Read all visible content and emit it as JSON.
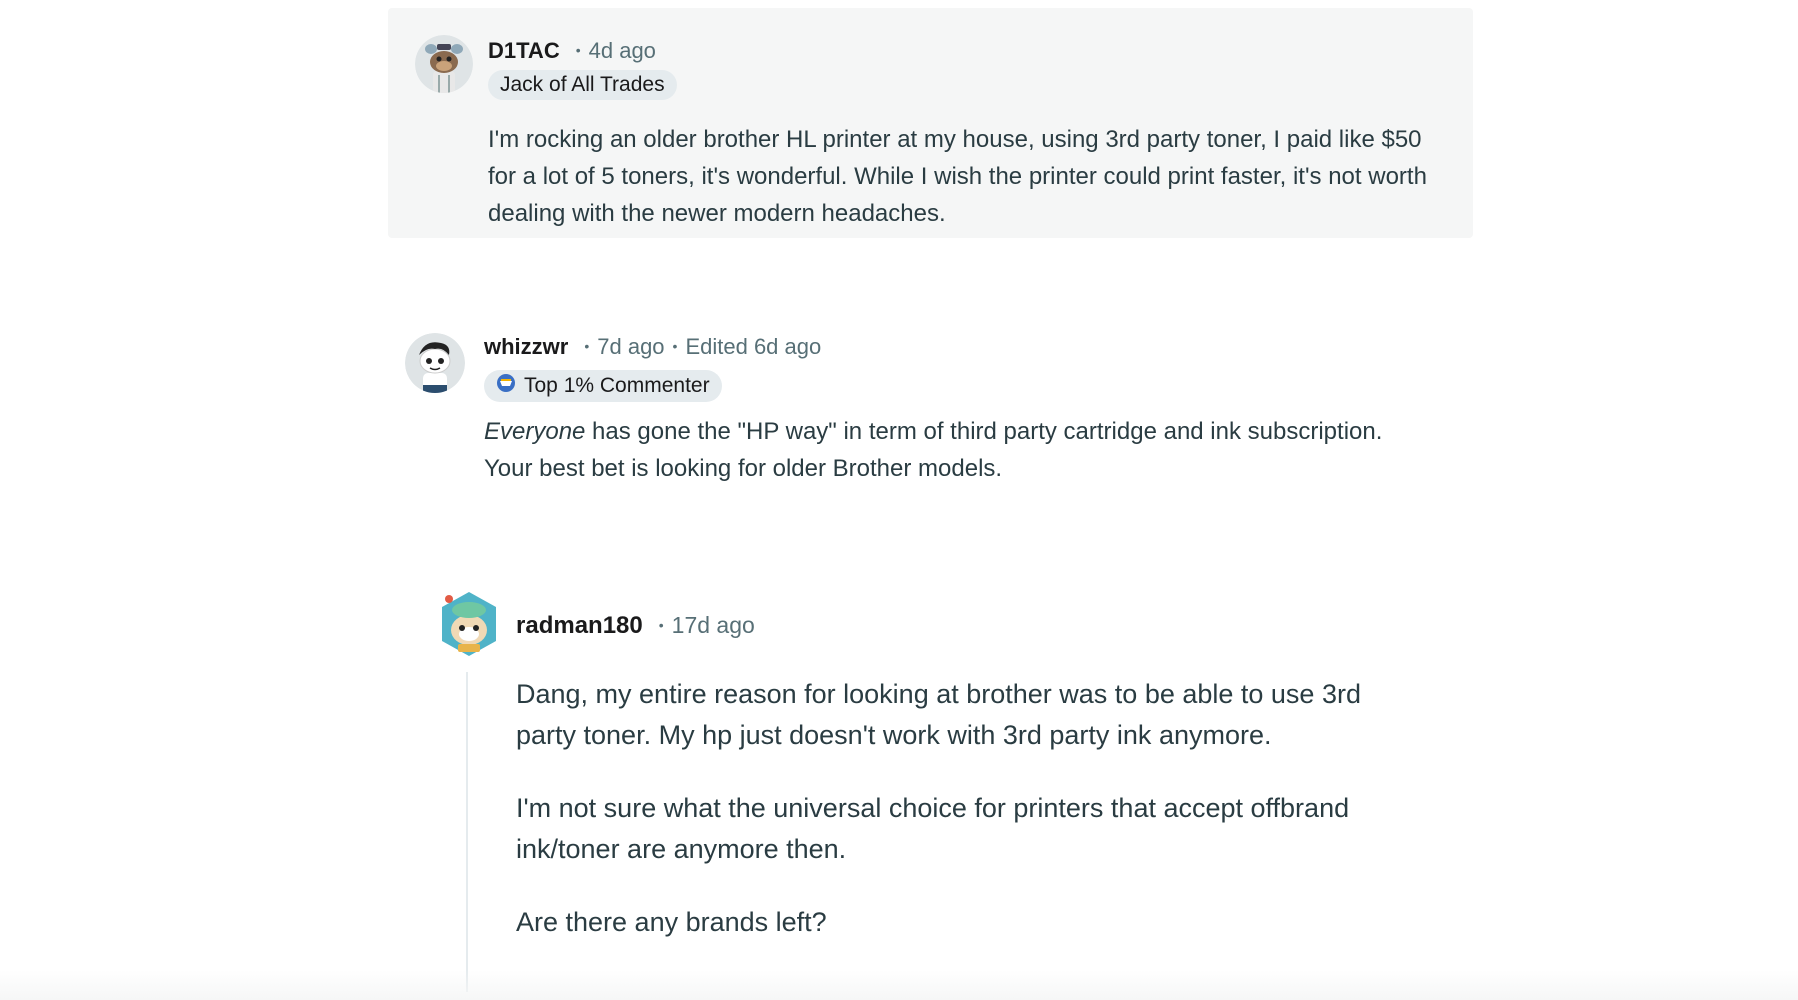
{
  "comments": [
    {
      "username": "D1TAC",
      "time": "4d ago",
      "flair": "Jack of All Trades",
      "avatar_icon": "snoo-avatar-icon",
      "body": [
        "I'm rocking an older brother HL printer at my house, using 3rd party toner, I paid like $50 for a lot of 5 toners, it's wonderful. While I wish the printer could print faster, it's not worth dealing with the newer modern headaches."
      ]
    },
    {
      "username": "whizzwr",
      "time": "7d ago",
      "edited": "Edited 6d ago",
      "flair": "Top 1% Commenter",
      "flair_icon": "top-commenter-badge-icon",
      "avatar_icon": "snoo-avatar-icon",
      "body_emphasis": "Everyone",
      "body_rest": " has gone the \"HP way\" in term of third party cartridge and ink subscription. Your best bet is looking for older Brother models."
    },
    {
      "username": "radman180",
      "time": "17d ago",
      "avatar_icon": "snoo-avatar-icon",
      "body": [
        "Dang, my entire reason for looking at brother was to be able to use 3rd party toner. My hp just doesn't work with 3rd party ink anymore.",
        "I'm not sure what the universal choice for printers that accept offbrand ink/toner are anymore then.",
        "Are there any brands left?"
      ]
    }
  ],
  "colors": {
    "highlight_bg": "#f5f6f6",
    "text": "#2a3c42",
    "meta": "#576f76",
    "flair_bg": "#e5ebee"
  }
}
